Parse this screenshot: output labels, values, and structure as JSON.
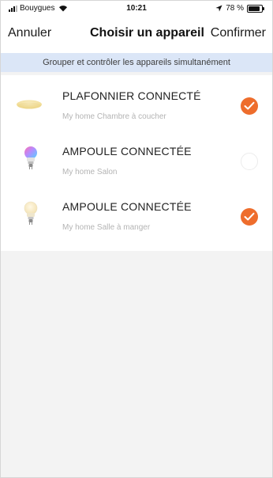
{
  "status_bar": {
    "carrier": "Bouygues",
    "time": "10:21",
    "battery_text": "78 %",
    "battery_level": 0.78
  },
  "nav": {
    "cancel_label": "Annuler",
    "title": "Choisir un appareil",
    "confirm_label": "Confirmer"
  },
  "banner": {
    "text": "Grouper et contrôler les appareils simultanément"
  },
  "devices": [
    {
      "name": "PLAFONNIER CONNECTÉ",
      "location": "My home Chambre à coucher",
      "icon": "ceiling-light-icon",
      "selected": true
    },
    {
      "name": "AMPOULE CONNECTÉE",
      "location": "My home Salon",
      "icon": "color-bulb-icon",
      "selected": false
    },
    {
      "name": "AMPOULE CONNECTÉE",
      "location": "My home Salle à manger",
      "icon": "white-bulb-icon",
      "selected": true
    }
  ],
  "colors": {
    "accent": "#ee6d2c",
    "banner_bg": "#dbe6f7",
    "page_bg": "#f3f3f3"
  }
}
